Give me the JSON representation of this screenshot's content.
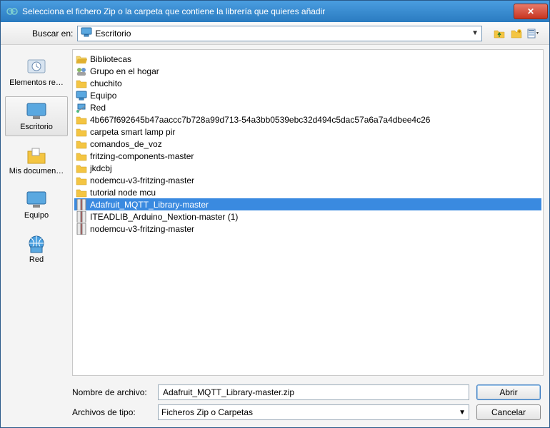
{
  "title": "Selecciona el fichero Zip o la carpeta que contiene la librería que quieres añadir",
  "lookin_label": "Buscar en:",
  "lookin_value": "Escritorio",
  "places": [
    {
      "label": "Elementos re…",
      "icon": "recent"
    },
    {
      "label": "Escritorio",
      "icon": "desktop",
      "selected": true
    },
    {
      "label": "Mis documen…",
      "icon": "documents"
    },
    {
      "label": "Equipo",
      "icon": "computer"
    },
    {
      "label": "Red",
      "icon": "network"
    }
  ],
  "files": [
    {
      "name": "Bibliotecas",
      "icon": "folder-open"
    },
    {
      "name": "Grupo en el hogar",
      "icon": "group"
    },
    {
      "name": "chuchito",
      "icon": "folder"
    },
    {
      "name": "Equipo",
      "icon": "computer-sm"
    },
    {
      "name": "Red",
      "icon": "network-sm"
    },
    {
      "name": "4b667f692645b47aaccc7b728a99d713-54a3bb0539ebc32d494c5dac57a6a7a4dbee4c26",
      "icon": "folder"
    },
    {
      "name": "carpeta smart lamp pir",
      "icon": "folder"
    },
    {
      "name": "comandos_de_voz",
      "icon": "folder"
    },
    {
      "name": "fritzing-components-master",
      "icon": "folder"
    },
    {
      "name": "jkdcbj",
      "icon": "folder"
    },
    {
      "name": "nodemcu-v3-fritzing-master",
      "icon": "folder"
    },
    {
      "name": "tutorial node mcu",
      "icon": "folder"
    },
    {
      "name": "Adafruit_MQTT_Library-master",
      "icon": "zip",
      "selected": true
    },
    {
      "name": "ITEADLIB_Arduino_Nextion-master (1)",
      "icon": "zip"
    },
    {
      "name": "nodemcu-v3-fritzing-master",
      "icon": "zip"
    }
  ],
  "filename_label": "Nombre de archivo:",
  "filename_value": "Adafruit_MQTT_Library-master.zip",
  "filetype_label": "Archivos de tipo:",
  "filetype_value": "Ficheros Zip o Carpetas",
  "open_label": "Abrir",
  "cancel_label": "Cancelar"
}
